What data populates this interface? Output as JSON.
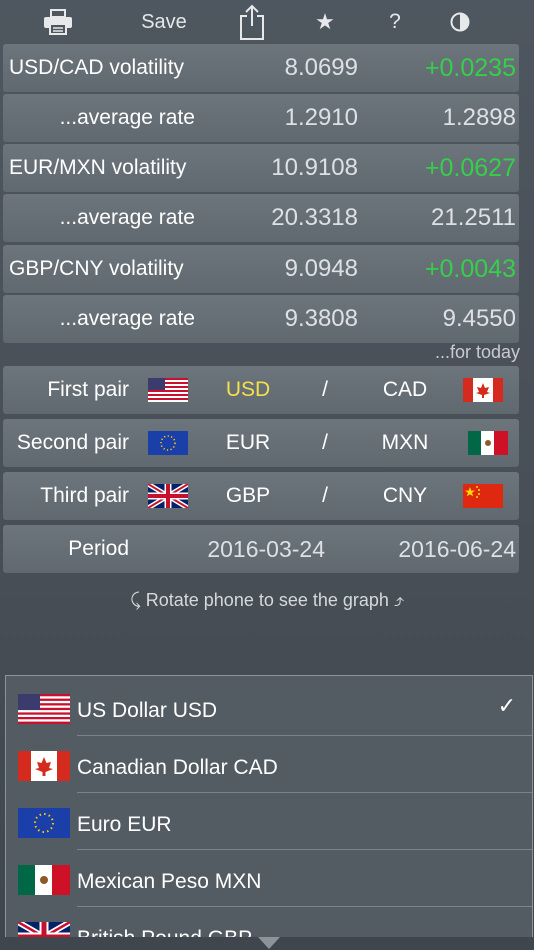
{
  "toolbar": {
    "print_icon": "printer-icon",
    "save_label": "Save",
    "share_icon": "share-icon",
    "star_label": "★",
    "help_label": "?",
    "contrast_icon": "contrast-icon"
  },
  "volatility": [
    {
      "pair": "USD/CAD volatility",
      "value": "8.0699",
      "change": "+0.0235",
      "avg_label": "...average rate",
      "avg_start": "1.2910",
      "avg_end": "1.2898"
    },
    {
      "pair": "EUR/MXN volatility",
      "value": "10.9108",
      "change": "+0.0627",
      "avg_label": "...average rate",
      "avg_start": "20.3318",
      "avg_end": "21.2511"
    },
    {
      "pair": "GBP/CNY volatility",
      "value": "9.0948",
      "change": "+0.0043",
      "avg_label": "...average rate",
      "avg_start": "9.3808",
      "avg_end": "9.4550"
    }
  ],
  "for_today": "...for today",
  "pairs": [
    {
      "label": "First pair",
      "base": "USD",
      "slash": "/",
      "quote": "CAD",
      "base_flag": "us-flag-icon",
      "quote_flag": "canada-flag-icon"
    },
    {
      "label": "Second pair",
      "base": "EUR",
      "slash": "/",
      "quote": "MXN",
      "base_flag": "eu-flag-icon",
      "quote_flag": "mexico-flag-icon"
    },
    {
      "label": "Third pair",
      "base": "GBP",
      "slash": "/",
      "quote": "CNY",
      "base_flag": "uk-flag-icon",
      "quote_flag": "china-flag-icon"
    }
  ],
  "period": {
    "label": "Period",
    "start": "2016-03-24",
    "end": "2016-06-24"
  },
  "rotate_hint": "⤹ Rotate phone to see the graph ⤴",
  "picker": {
    "items": [
      {
        "name": "US Dollar USD",
        "flag": "us-flag-icon",
        "selected": true
      },
      {
        "name": "Canadian Dollar CAD",
        "flag": "canada-flag-icon",
        "selected": false
      },
      {
        "name": "Euro EUR",
        "flag": "eu-flag-icon",
        "selected": false
      },
      {
        "name": "Mexican Peso MXN",
        "flag": "mexico-flag-icon",
        "selected": false
      },
      {
        "name": "British Pound GBP",
        "flag": "uk-flag-icon",
        "selected": false
      }
    ],
    "check": "✓"
  },
  "colors": {
    "positive": "#35d04a",
    "highlight": "#f4e04b",
    "row": "#666e76",
    "background": "#4b535b"
  }
}
